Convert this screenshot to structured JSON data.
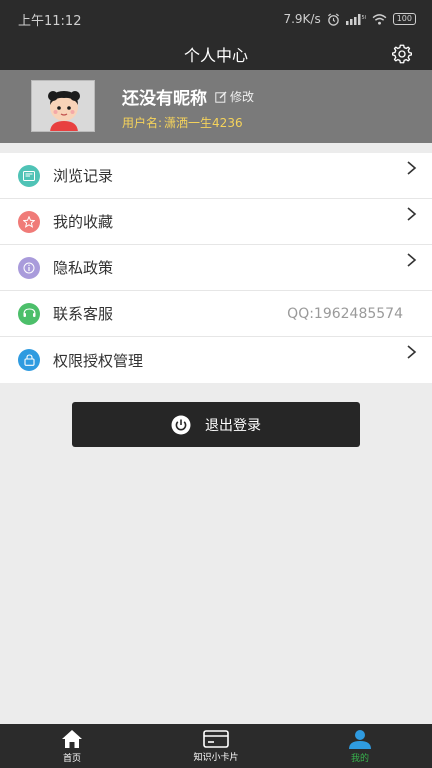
{
  "status_bar": {
    "time": "上午11:12",
    "speed": "7.9K/s",
    "battery": "100"
  },
  "header": {
    "title": "个人中心",
    "settings_icon": "gear-icon"
  },
  "profile": {
    "nickname": "还没有昵称",
    "edit_label": "修改",
    "username_label": "用户名:",
    "username_value": "潇洒一生4236"
  },
  "menu": {
    "items": [
      {
        "label": "浏览记录",
        "icon": "history-icon",
        "color": "#4fc3b6"
      },
      {
        "label": "我的收藏",
        "icon": "star-icon",
        "color": "#f07b78"
      },
      {
        "label": "隐私政策",
        "icon": "info-icon",
        "color": "#a99bdb"
      },
      {
        "label": "联系客服",
        "icon": "customer-service-icon",
        "color": "#4cbf6a",
        "value": "QQ:1962485574"
      },
      {
        "label": "权限授权管理",
        "icon": "lock-icon",
        "color": "#2f9be0"
      }
    ]
  },
  "logout": {
    "label": "退出登录",
    "icon": "power-icon"
  },
  "tabbar": {
    "items": [
      {
        "label": "首页",
        "icon": "home-icon",
        "active": false
      },
      {
        "label": "知识小卡片",
        "icon": "card-icon",
        "active": false
      },
      {
        "label": "我的",
        "icon": "user-icon",
        "active": true
      }
    ],
    "active_color": "#37b24d"
  }
}
